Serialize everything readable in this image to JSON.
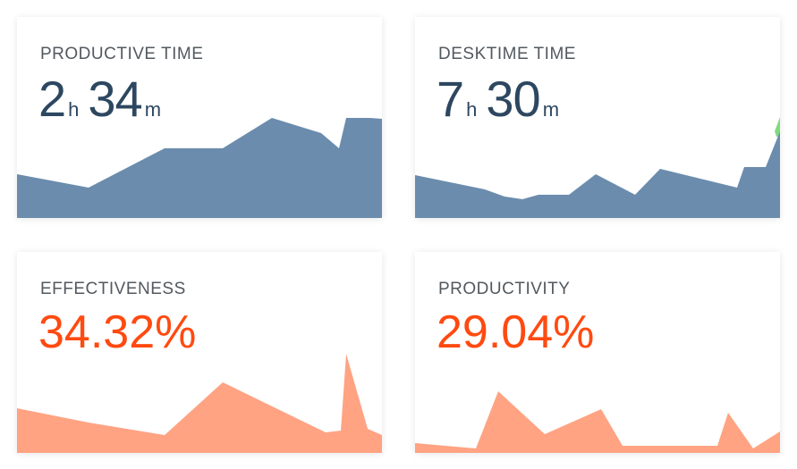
{
  "colors": {
    "blue_area": "#6b8cad",
    "orange_area": "#ffa383",
    "green_accent": "#7ddc7d",
    "time_value": "#2d4760",
    "percent_value": "#ff4a10",
    "title": "#52595f"
  },
  "cards": {
    "productive_time": {
      "title": "PRODUCTIVE TIME",
      "hours": "2",
      "hours_unit": "h",
      "minutes": "34",
      "minutes_unit": "m",
      "trend": [
        0.48,
        0.4,
        0.34,
        0.68,
        0.68,
        0.98,
        0.85,
        0.7,
        0.99,
        0.98
      ]
    },
    "desktime_time": {
      "title": "DESKTIME TIME",
      "hours": "7",
      "hours_unit": "h",
      "minutes": "30",
      "minutes_unit": "m",
      "trend": [
        0.32,
        0.2,
        0.12,
        0.14,
        0.29,
        0.16,
        0.34,
        0.21,
        0.37,
        0.37,
        0.65
      ]
    },
    "effectiveness": {
      "title": "EFFECTIVENESS",
      "value": "34.32%",
      "trend": [
        0.28,
        0.18,
        0.1,
        0.45,
        0.12,
        0.13,
        0.68,
        0.12,
        0.05
      ]
    },
    "productivity": {
      "title": "PRODUCTIVITY",
      "value": "29.04%",
      "trend": [
        0.06,
        0.02,
        0.57,
        0.18,
        0.4,
        0.05,
        0.05,
        0.37,
        0.04,
        0.18
      ]
    }
  }
}
